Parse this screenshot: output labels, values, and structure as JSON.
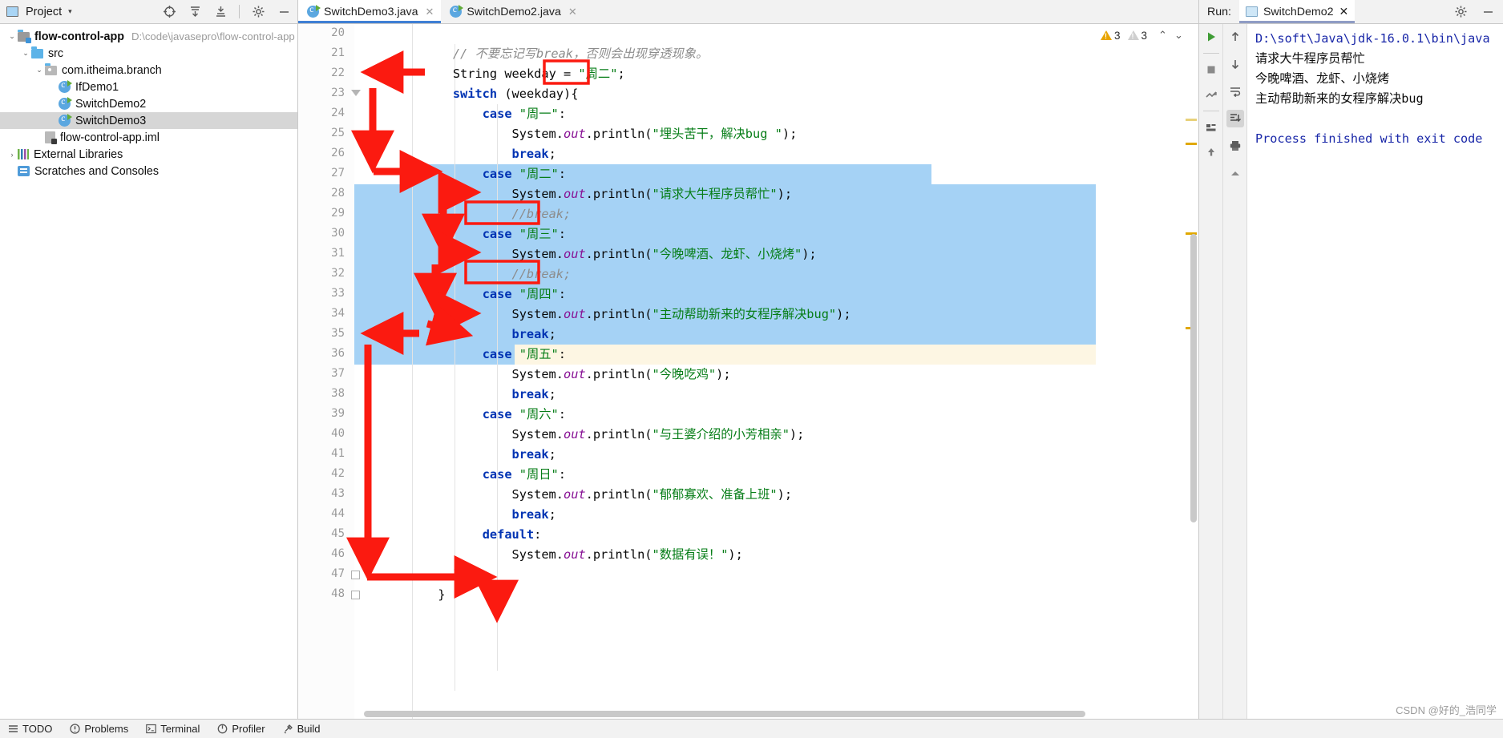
{
  "project_panel": {
    "title": "Project",
    "caret": "▾",
    "toolbar_icons": [
      "locate-icon",
      "expand-all-icon",
      "collapse-all-icon",
      "settings-icon",
      "minimize-icon"
    ],
    "tree": [
      {
        "label": "flow-control-app",
        "path": "D:\\code\\javasepro\\flow-control-app",
        "icon": "module-folder-icon",
        "arrow": "⌄",
        "indent": 0,
        "bold": true,
        "selected": false
      },
      {
        "label": "src",
        "path": "",
        "icon": "source-folder-icon",
        "arrow": "⌄",
        "indent": 1,
        "bold": false,
        "selected": false
      },
      {
        "label": "com.itheima.branch",
        "path": "",
        "icon": "package-icon",
        "arrow": "⌄",
        "indent": 2,
        "bold": false,
        "selected": false
      },
      {
        "label": "IfDemo1",
        "path": "",
        "icon": "java-class-icon",
        "arrow": "",
        "indent": 3,
        "bold": false,
        "selected": false
      },
      {
        "label": "SwitchDemo2",
        "path": "",
        "icon": "java-class-icon",
        "arrow": "",
        "indent": 3,
        "bold": false,
        "selected": false
      },
      {
        "label": "SwitchDemo3",
        "path": "",
        "icon": "java-class-icon",
        "arrow": "",
        "indent": 3,
        "bold": false,
        "selected": true
      },
      {
        "label": "flow-control-app.iml",
        "path": "",
        "icon": "iml-file-icon",
        "arrow": "",
        "indent": 2,
        "bold": false,
        "selected": false
      },
      {
        "label": "External Libraries",
        "path": "",
        "icon": "libraries-icon",
        "arrow": "›",
        "indent": 0,
        "bold": false,
        "selected": false
      },
      {
        "label": "Scratches and Consoles",
        "path": "",
        "icon": "scratches-icon",
        "arrow": "",
        "indent": 0,
        "bold": false,
        "selected": false
      }
    ]
  },
  "editor_tabs": [
    {
      "label": "SwitchDemo3.java",
      "active": true,
      "close": "✕"
    },
    {
      "label": "SwitchDemo2.java",
      "active": false,
      "close": "✕"
    }
  ],
  "inspection": {
    "warning_count": "3",
    "weak_warning_count": "3",
    "up_chevron": "⌃",
    "down_chevron": "⌄"
  },
  "code": {
    "first_line_number": 20,
    "lines": [
      {
        "n": 20,
        "tokens": []
      },
      {
        "n": 21,
        "tokens": [
          {
            "t": "    ",
            "c": "pln"
          },
          {
            "t": "// 不要忘记写break，否则会出现穿透现象。",
            "c": "cmt"
          }
        ]
      },
      {
        "n": 22,
        "tokens": [
          {
            "t": "    ",
            "c": "pln"
          },
          {
            "t": "String",
            "c": "pln"
          },
          {
            "t": " weekday = ",
            "c": "pln"
          },
          {
            "t": "\"周二\"",
            "c": "str"
          },
          {
            "t": ";",
            "c": "pln"
          }
        ]
      },
      {
        "n": 23,
        "tokens": [
          {
            "t": "    ",
            "c": "pln"
          },
          {
            "t": "switch",
            "c": "kw"
          },
          {
            "t": " (weekday){",
            "c": "pln"
          }
        ]
      },
      {
        "n": 24,
        "tokens": [
          {
            "t": "        ",
            "c": "pln"
          },
          {
            "t": "case",
            "c": "kw"
          },
          {
            "t": " ",
            "c": "pln"
          },
          {
            "t": "\"周一\"",
            "c": "str"
          },
          {
            "t": ":",
            "c": "pln"
          }
        ]
      },
      {
        "n": 25,
        "tokens": [
          {
            "t": "            System.",
            "c": "pln"
          },
          {
            "t": "out",
            "c": "fld"
          },
          {
            "t": ".println(",
            "c": "pln"
          },
          {
            "t": "\"埋头苦干，解决bug \"",
            "c": "str"
          },
          {
            "t": ");",
            "c": "pln"
          }
        ]
      },
      {
        "n": 26,
        "tokens": [
          {
            "t": "            ",
            "c": "pln"
          },
          {
            "t": "break",
            "c": "kw"
          },
          {
            "t": ";",
            "c": "pln"
          }
        ]
      },
      {
        "n": 27,
        "tokens": [
          {
            "t": "        ",
            "c": "pln"
          },
          {
            "t": "case",
            "c": "kw"
          },
          {
            "t": " ",
            "c": "pln"
          },
          {
            "t": "\"周二\"",
            "c": "str"
          },
          {
            "t": ":",
            "c": "pln"
          }
        ]
      },
      {
        "n": 28,
        "tokens": [
          {
            "t": "            System.",
            "c": "pln"
          },
          {
            "t": "out",
            "c": "fld"
          },
          {
            "t": ".println(",
            "c": "pln"
          },
          {
            "t": "\"请求大牛程序员帮忙\"",
            "c": "str"
          },
          {
            "t": ");",
            "c": "pln"
          }
        ]
      },
      {
        "n": 29,
        "tokens": [
          {
            "t": "            ",
            "c": "pln"
          },
          {
            "t": "//break;",
            "c": "cmt"
          }
        ]
      },
      {
        "n": 30,
        "tokens": [
          {
            "t": "        ",
            "c": "pln"
          },
          {
            "t": "case",
            "c": "kw"
          },
          {
            "t": " ",
            "c": "pln"
          },
          {
            "t": "\"周三\"",
            "c": "str"
          },
          {
            "t": ":",
            "c": "pln"
          }
        ]
      },
      {
        "n": 31,
        "tokens": [
          {
            "t": "            System.",
            "c": "pln"
          },
          {
            "t": "out",
            "c": "fld"
          },
          {
            "t": ".println(",
            "c": "pln"
          },
          {
            "t": "\"今晚啤酒、龙虾、小烧烤\"",
            "c": "str"
          },
          {
            "t": ");",
            "c": "pln"
          }
        ]
      },
      {
        "n": 32,
        "tokens": [
          {
            "t": "            ",
            "c": "pln"
          },
          {
            "t": "//break;",
            "c": "cmt"
          }
        ]
      },
      {
        "n": 33,
        "tokens": [
          {
            "t": "        ",
            "c": "pln"
          },
          {
            "t": "case",
            "c": "kw"
          },
          {
            "t": " ",
            "c": "pln"
          },
          {
            "t": "\"周四\"",
            "c": "str"
          },
          {
            "t": ":",
            "c": "pln"
          }
        ]
      },
      {
        "n": 34,
        "tokens": [
          {
            "t": "            System.",
            "c": "pln"
          },
          {
            "t": "out",
            "c": "fld"
          },
          {
            "t": ".println(",
            "c": "pln"
          },
          {
            "t": "\"主动帮助新来的女程序解决bug\"",
            "c": "str"
          },
          {
            "t": ");",
            "c": "pln"
          }
        ]
      },
      {
        "n": 35,
        "tokens": [
          {
            "t": "            ",
            "c": "pln"
          },
          {
            "t": "break",
            "c": "kw"
          },
          {
            "t": ";",
            "c": "pln"
          }
        ]
      },
      {
        "n": 36,
        "tokens": [
          {
            "t": "        ",
            "c": "pln"
          },
          {
            "t": "case",
            "c": "kw"
          },
          {
            "t": " ",
            "c": "pln"
          },
          {
            "t": "\"周五\"",
            "c": "str"
          },
          {
            "t": ":",
            "c": "pln"
          }
        ]
      },
      {
        "n": 37,
        "tokens": [
          {
            "t": "            System.",
            "c": "pln"
          },
          {
            "t": "out",
            "c": "fld"
          },
          {
            "t": ".println(",
            "c": "pln"
          },
          {
            "t": "\"今晚吃鸡\"",
            "c": "str"
          },
          {
            "t": ");",
            "c": "pln"
          }
        ]
      },
      {
        "n": 38,
        "tokens": [
          {
            "t": "            ",
            "c": "pln"
          },
          {
            "t": "break",
            "c": "kw"
          },
          {
            "t": ";",
            "c": "pln"
          }
        ]
      },
      {
        "n": 39,
        "tokens": [
          {
            "t": "        ",
            "c": "pln"
          },
          {
            "t": "case",
            "c": "kw"
          },
          {
            "t": " ",
            "c": "pln"
          },
          {
            "t": "\"周六\"",
            "c": "str"
          },
          {
            "t": ":",
            "c": "pln"
          }
        ]
      },
      {
        "n": 40,
        "tokens": [
          {
            "t": "            System.",
            "c": "pln"
          },
          {
            "t": "out",
            "c": "fld"
          },
          {
            "t": ".println(",
            "c": "pln"
          },
          {
            "t": "\"与王婆介绍的小芳相亲\"",
            "c": "str"
          },
          {
            "t": ");",
            "c": "pln"
          }
        ]
      },
      {
        "n": 41,
        "tokens": [
          {
            "t": "            ",
            "c": "pln"
          },
          {
            "t": "break",
            "c": "kw"
          },
          {
            "t": ";",
            "c": "pln"
          }
        ]
      },
      {
        "n": 42,
        "tokens": [
          {
            "t": "        ",
            "c": "pln"
          },
          {
            "t": "case",
            "c": "kw"
          },
          {
            "t": " ",
            "c": "pln"
          },
          {
            "t": "\"周日\"",
            "c": "str"
          },
          {
            "t": ":",
            "c": "pln"
          }
        ]
      },
      {
        "n": 43,
        "tokens": [
          {
            "t": "            System.",
            "c": "pln"
          },
          {
            "t": "out",
            "c": "fld"
          },
          {
            "t": ".println(",
            "c": "pln"
          },
          {
            "t": "\"郁郁寡欢、准备上班\"",
            "c": "str"
          },
          {
            "t": ");",
            "c": "pln"
          }
        ]
      },
      {
        "n": 44,
        "tokens": [
          {
            "t": "            ",
            "c": "pln"
          },
          {
            "t": "break",
            "c": "kw"
          },
          {
            "t": ";",
            "c": "pln"
          }
        ]
      },
      {
        "n": 45,
        "tokens": [
          {
            "t": "        ",
            "c": "pln"
          },
          {
            "t": "default",
            "c": "kw"
          },
          {
            "t": ":",
            "c": "pln"
          }
        ]
      },
      {
        "n": 46,
        "tokens": [
          {
            "t": "            System.",
            "c": "pln"
          },
          {
            "t": "out",
            "c": "fld"
          },
          {
            "t": ".println(",
            "c": "pln"
          },
          {
            "t": "\"数据有误！\"",
            "c": "str"
          },
          {
            "t": ");",
            "c": "pln"
          }
        ]
      },
      {
        "n": 47,
        "tokens": [
          {
            "t": "    }",
            "c": "pln"
          }
        ]
      },
      {
        "n": 48,
        "tokens": [
          {
            "t": "  }",
            "c": "pln"
          }
        ]
      }
    ]
  },
  "run_panel": {
    "run_label": "Run:",
    "tab_label": "SwitchDemo2",
    "tab_close": "✕",
    "header_icons": [
      "settings-icon",
      "minimize-icon"
    ],
    "left_toolbar": [
      "rerun-icon",
      "stop-icon",
      "restore-layout-icon",
      "dump-threads-icon",
      "pin-icon"
    ],
    "right_toolbar": [
      "scroll-up-icon",
      "scroll-down-icon",
      "soft-wrap-icon",
      "scroll-to-end-icon",
      "print-icon",
      "clear-all-icon"
    ],
    "console_lines": [
      {
        "text": "D:\\soft\\Java\\jdk-16.0.1\\bin\\java",
        "style": "blue"
      },
      {
        "text": "请求大牛程序员帮忙",
        "style": "plain"
      },
      {
        "text": "今晚啤酒、龙虾、小烧烤",
        "style": "plain"
      },
      {
        "text": "主动帮助新来的女程序解决bug",
        "style": "plain"
      },
      {
        "text": "",
        "style": "plain"
      },
      {
        "text": "Process finished with exit code",
        "style": "blue"
      }
    ]
  },
  "status_bar": {
    "items": [
      {
        "label": "TODO",
        "icon": "todo-icon"
      },
      {
        "label": "Problems",
        "icon": "problems-icon"
      },
      {
        "label": "Terminal",
        "icon": "terminal-icon"
      },
      {
        "label": "Profiler",
        "icon": "profiler-icon"
      },
      {
        "label": "Build",
        "icon": "build-icon"
      }
    ]
  },
  "watermark": "CSDN @好的_浩同学",
  "colors": {
    "selection_blue": "#a5d2f5",
    "annotation_red": "#fb1a10",
    "keyword_blue": "#0033b3",
    "string_green": "#067d17",
    "field_purple": "#871094"
  }
}
